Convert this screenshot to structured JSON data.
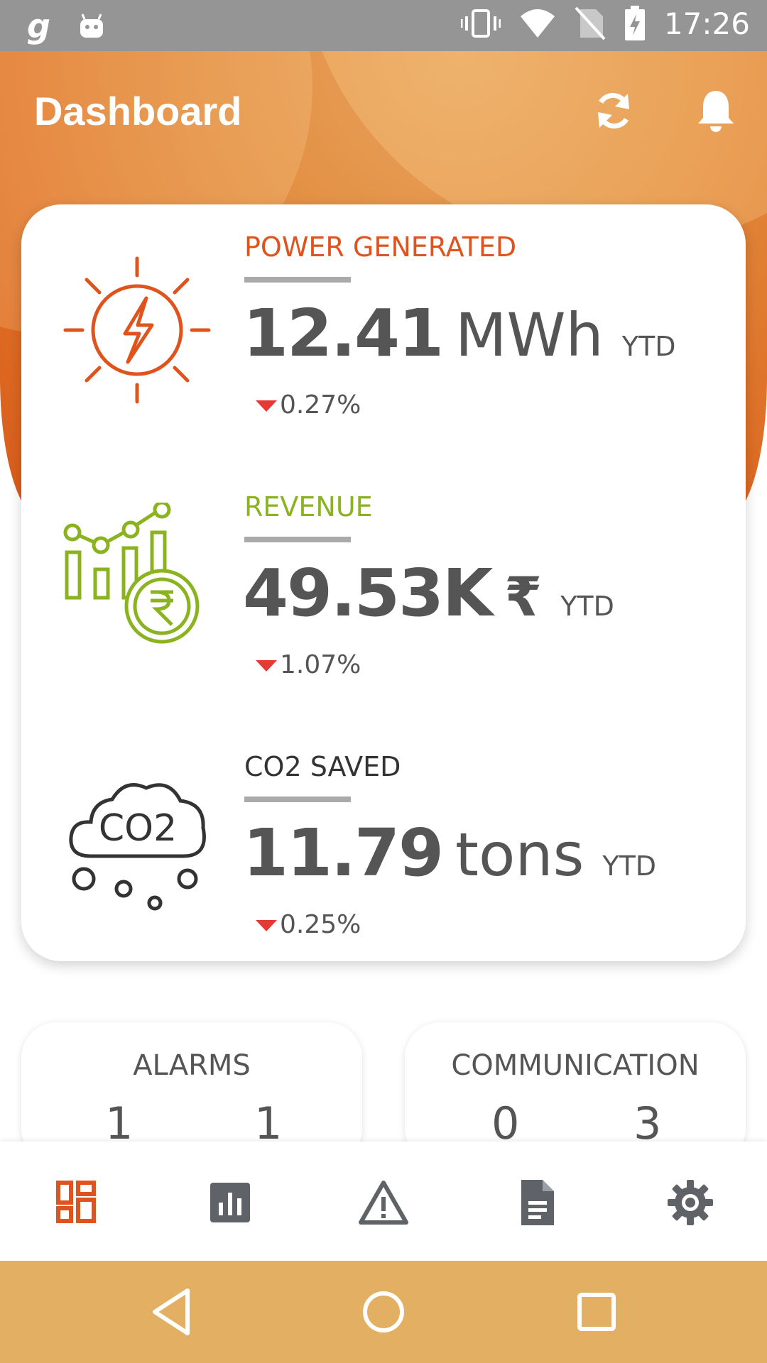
{
  "status_bar": {
    "time": "17:26",
    "left_app_glyph": "g"
  },
  "header": {
    "title": "Dashboard",
    "refresh_icon": "refresh-icon",
    "bell_icon": "bell-icon"
  },
  "kpis": [
    {
      "label": "POWER GENERATED",
      "value": "12.41",
      "unit": "MWh",
      "period": "YTD",
      "change": "0.27%",
      "color": "#e0531d",
      "icon": "sun-bolt-icon"
    },
    {
      "label": "REVENUE",
      "value": "49.53K",
      "unit": "₹",
      "period": "YTD",
      "change": "1.07%",
      "color": "#8ab31f",
      "icon": "revenue-chart-icon"
    },
    {
      "label": "CO2 SAVED",
      "value": "11.79",
      "unit": "tons",
      "period": "YTD",
      "change": "0.25%",
      "color": "#333333",
      "icon": "co2-cloud-icon",
      "icon_text": "CO2"
    }
  ],
  "alarms": {
    "title": "ALARMS",
    "values": [
      "1",
      "1"
    ]
  },
  "communication": {
    "title": "COMMUNICATION",
    "values": [
      "0",
      "3"
    ]
  },
  "bottom_nav": [
    "dashboard",
    "reports",
    "alarms",
    "documents",
    "settings"
  ],
  "colors": {
    "accent": "#e0531d",
    "revenue": "#8ab31f",
    "nav_inactive": "#5f6368",
    "system_nav_bg": "#e3af62",
    "status_bar_bg": "#959595",
    "down_arrow": "#e53935"
  }
}
